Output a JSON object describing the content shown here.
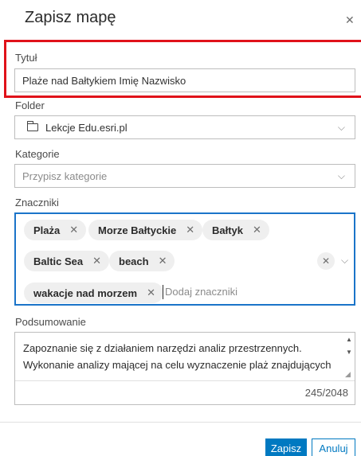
{
  "dialog": {
    "title": "Zapisz mapę",
    "close_icon": "close-icon"
  },
  "title_field": {
    "label": "Tytuł",
    "value": "Plaże nad Bałtykiem Imię Nazwisko"
  },
  "folder_field": {
    "label": "Folder",
    "value": "Lekcje Edu.esri.pl",
    "icon": "folder-icon"
  },
  "category_field": {
    "label": "Kategorie",
    "placeholder": "Przypisz kategorie"
  },
  "tags_field": {
    "label": "Znaczniki",
    "tags": [
      "Plaża",
      "Morze Bałtyckie",
      "Bałtyk",
      "Baltic Sea",
      "beach",
      "wakacje nad morzem"
    ],
    "input_placeholder": "Dodaj znaczniki"
  },
  "summary_field": {
    "label": "Podsumowanie",
    "text": "Zapoznanie się z działaniem narzędzi analiz przestrzennych. Wykonanie analizy mającej na celu wyznaczenie plaż znajdujących",
    "counter": "245/2048"
  },
  "footer": {
    "save_label": "Zapisz",
    "cancel_label": "Anuluj"
  },
  "colors": {
    "accent": "#0079c1",
    "highlight": "#e0121a",
    "focus": "#1b74c9"
  }
}
